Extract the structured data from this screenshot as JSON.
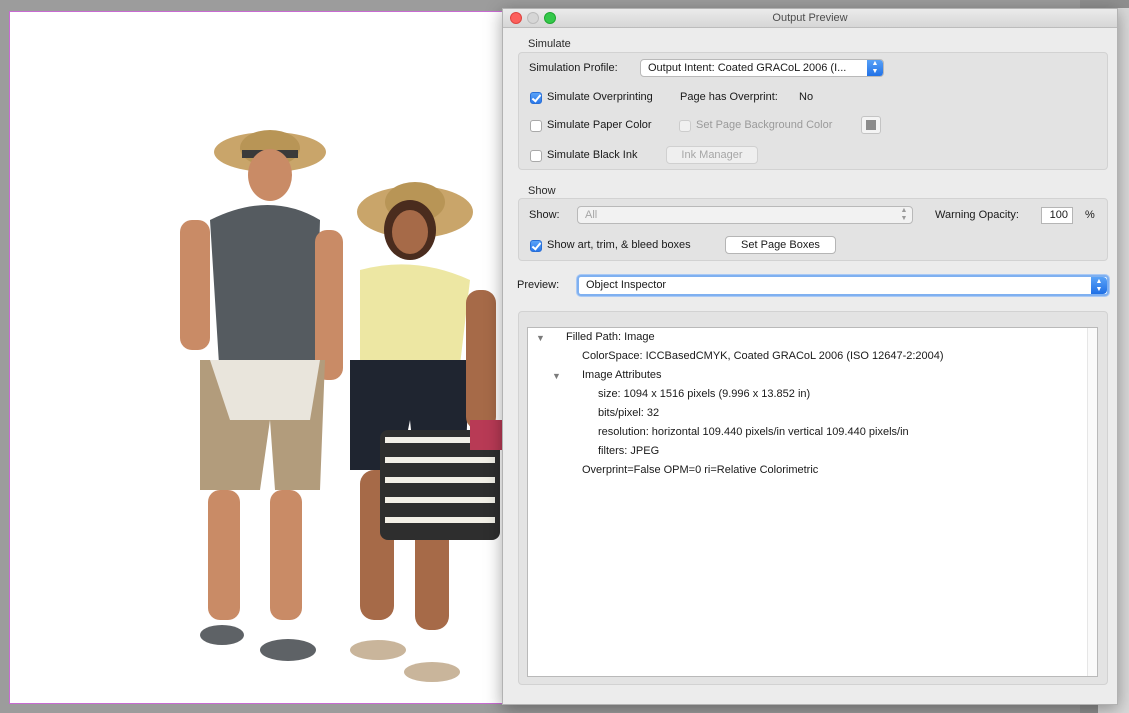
{
  "window": {
    "title": "Output Preview"
  },
  "simulate": {
    "group_label": "Simulate",
    "profile_label": "Simulation Profile:",
    "profile_value": "Output Intent: Coated GRACoL 2006 (I...",
    "overprinting_label": "Simulate Overprinting",
    "overprinting_checked": true,
    "page_overprint_label": "Page has Overprint:",
    "page_overprint_value": "No",
    "paper_color_label": "Simulate Paper Color",
    "paper_color_checked": false,
    "page_bg_label": "Set Page Background Color",
    "black_ink_label": "Simulate Black Ink",
    "black_ink_checked": false,
    "ink_manager_label": "Ink Manager"
  },
  "show": {
    "group_label": "Show",
    "show_label": "Show:",
    "show_value": "All",
    "warning_opacity_label": "Warning Opacity:",
    "warning_opacity_value": "100",
    "percent_sign": "%",
    "boxes_label": "Show art, trim, & bleed boxes",
    "boxes_checked": true,
    "set_page_boxes_label": "Set Page Boxes"
  },
  "preview": {
    "label": "Preview:",
    "value": "Object Inspector"
  },
  "inspector": {
    "rows": [
      {
        "text": "Filled Path: Image",
        "disclosure": "expanded"
      },
      {
        "text": "ColorSpace: ICCBasedCMYK, Coated GRACoL 2006 (ISO 12647-2:2004)"
      },
      {
        "text": "Image Attributes",
        "disclosure": "expanded"
      },
      {
        "text": "size: 1094 x 1516 pixels (9.996 x 13.852 in)"
      },
      {
        "text": "bits/pixel: 32"
      },
      {
        "text": "resolution: horizontal 109.440 pixels/in vertical 109.440 pixels/in"
      },
      {
        "text": "filters: JPEG"
      },
      {
        "text": "Overprint=False OPM=0 ri=Relative Colorimetric"
      }
    ]
  },
  "colors": {
    "accent": "#2a78ea",
    "page_border": "#c86bd2",
    "swatch": "#8c8c8c"
  }
}
